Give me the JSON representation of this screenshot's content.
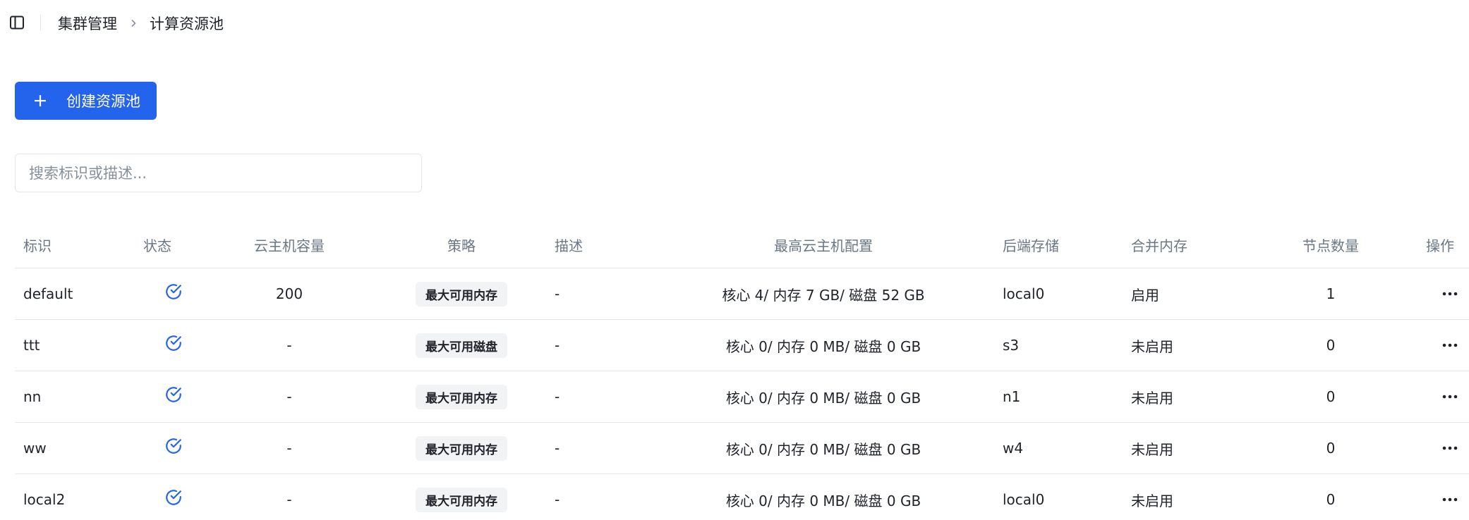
{
  "breadcrumb": {
    "parent": "集群管理",
    "current": "计算资源池"
  },
  "toolbar": {
    "create_label": "创建资源池"
  },
  "search": {
    "placeholder": "搜索标识或描述..."
  },
  "table": {
    "headers": {
      "id": "标识",
      "status": "状态",
      "capacity": "云主机容量",
      "policy": "策略",
      "desc": "描述",
      "max_config": "最高云主机配置",
      "backend": "后端存储",
      "merge": "合并内存",
      "nodes": "节点数量",
      "ops": "操作"
    },
    "rows": [
      {
        "id": "default",
        "status": "check-circle-icon",
        "capacity": "200",
        "policy": "最大可用内存",
        "desc": "-",
        "max_config": "核心 4/ 内存 7 GB/ 磁盘 52 GB",
        "backend": "local0",
        "merge": "启用",
        "nodes": "1"
      },
      {
        "id": "ttt",
        "status": "check-circle-icon",
        "capacity": "-",
        "policy": "最大可用磁盘",
        "desc": "-",
        "max_config": "核心 0/ 内存 0 MB/ 磁盘 0 GB",
        "backend": "s3",
        "merge": "未启用",
        "nodes": "0"
      },
      {
        "id": "nn",
        "status": "check-circle-icon",
        "capacity": "-",
        "policy": "最大可用内存",
        "desc": "-",
        "max_config": "核心 0/ 内存 0 MB/ 磁盘 0 GB",
        "backend": "n1",
        "merge": "未启用",
        "nodes": "0"
      },
      {
        "id": "ww",
        "status": "check-circle-icon",
        "capacity": "-",
        "policy": "最大可用内存",
        "desc": "-",
        "max_config": "核心 0/ 内存 0 MB/ 磁盘 0 GB",
        "backend": "w4",
        "merge": "未启用",
        "nodes": "0"
      },
      {
        "id": "local2",
        "status": "check-circle-icon",
        "capacity": "-",
        "policy": "最大可用内存",
        "desc": "-",
        "max_config": "核心 0/ 内存 0 MB/ 磁盘 0 GB",
        "backend": "local0",
        "merge": "未启用",
        "nodes": "0"
      }
    ]
  },
  "colors": {
    "primary": "#2463eb",
    "status_icon": "#2463eb",
    "border": "#e5e6eb",
    "header_text": "#6b7785"
  }
}
